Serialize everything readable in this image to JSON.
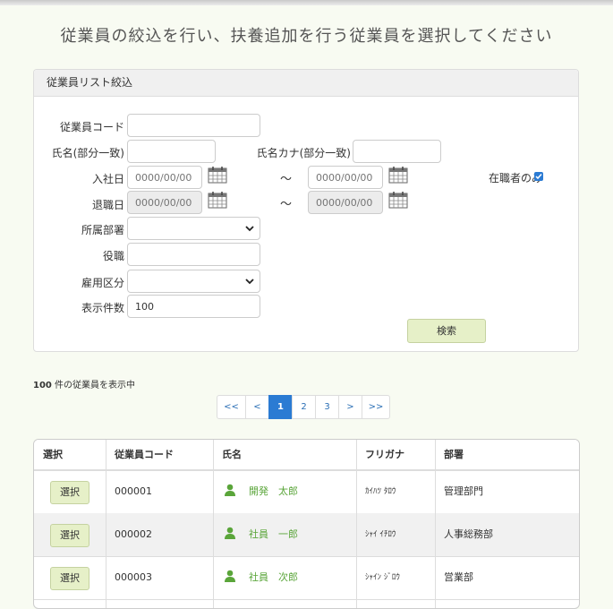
{
  "page_title": "従業員の絞込を行い、扶養追加を行う従業員を選択してください",
  "filter": {
    "heading": "従業員リスト絞込",
    "code_label": "従業員コード",
    "code_value": "",
    "name_label": "氏名(部分一致)",
    "name_value": "",
    "kana_label": "氏名カナ(部分一致)",
    "kana_value": "",
    "hire_label": "入社日",
    "hire_from_placeholder": "0000/00/00",
    "hire_to_placeholder": "0000/00/00",
    "retire_label": "退職日",
    "retire_from_placeholder": "0000/00/00",
    "retire_to_placeholder": "0000/00/00",
    "tilde": "～",
    "active_only_label": "在職者のみ",
    "active_only_checked": true,
    "dept_label": "所属部署",
    "dept_value": "",
    "position_label": "役職",
    "position_value": "",
    "employment_label": "雇用区分",
    "employment_value": "",
    "limit_label": "表示件数",
    "limit_value": "100",
    "search_button": "検索"
  },
  "result_count": {
    "number": "100",
    "text": " 件の従業員を表示中"
  },
  "pagination": {
    "first": "<<",
    "prev": "<",
    "pages": [
      "1",
      "2",
      "3"
    ],
    "current": "1",
    "next": ">",
    "last": ">>"
  },
  "table": {
    "columns": [
      "選択",
      "従業員コード",
      "氏名",
      "フリガナ",
      "部署"
    ],
    "select_button": "選択",
    "rows": [
      {
        "code": "000001",
        "name": "開発　太郎",
        "kana": "ｶｲﾊﾂ ﾀﾛｳ",
        "dept": "管理部門"
      },
      {
        "code": "000002",
        "name": "社員　一郎",
        "kana": "ｼｬｲ ｲﾁﾛｳ",
        "dept": "人事総務部"
      },
      {
        "code": "000003",
        "name": "社員　次郎",
        "kana": "ｼｬｲﾝ ｼﾞﾛｳ",
        "dept": "営業部"
      }
    ]
  },
  "colors": {
    "accent": "#2b7bd3",
    "button_bg": "#e6f0c8",
    "name_green": "#5aa53a",
    "page_bg": "#f8fbf2"
  },
  "icons": {
    "calendar": "calendar-icon",
    "person": "person-icon",
    "dropdown": "chevron-down-icon"
  }
}
